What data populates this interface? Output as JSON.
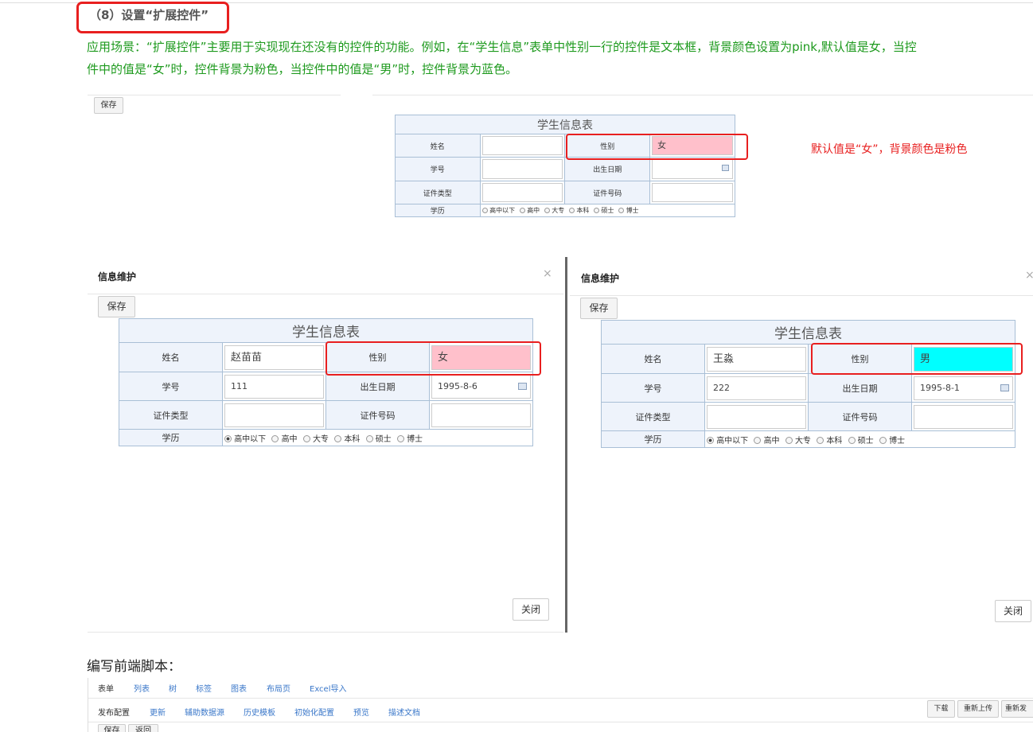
{
  "heading": "（8）设置“扩展控件”",
  "description": {
    "line1": "应用场景：“扩展控件”主要用于实现现在还没有的控件的功能。例如，在“学生信息”表单中性别一行的控件是文本框，背景颜色设置为pink,默认值是女，当控",
    "line2": "件中的值是“女”时，控件背景为粉色，当控件中的值是“男”时，控件背景为蓝色。"
  },
  "save_label": "保存",
  "close_label": "关闭",
  "dialog_title": "信息维护",
  "close_icon": "×",
  "form": {
    "caption": "学生信息表",
    "name_label": "姓名",
    "gender_label": "性别",
    "id_label": "学号",
    "birth_label": "出生日期",
    "cert_type_label": "证件类型",
    "cert_no_label": "证件号码",
    "edu_label": "学历",
    "edu_options": [
      "高中以下",
      "高中",
      "大专",
      "本科",
      "硕士",
      "博士"
    ]
  },
  "preview": {
    "gender": "女",
    "note": "默认值是“女”，背景颜色是粉色"
  },
  "dialog_left": {
    "name": "赵苗苗",
    "gender": "女",
    "id": "111",
    "birth": "1995-8-6"
  },
  "dialog_right": {
    "name": "王淼",
    "gender": "男",
    "id": "222",
    "birth": "1995-8-1"
  },
  "colors": {
    "female_bg": "#ffc0cb",
    "male_bg": "#00ffff",
    "highlight": "#e81f1f"
  },
  "script_heading": "编写前端脚本：",
  "designer": {
    "tabs": [
      "表单",
      "列表",
      "树",
      "标签",
      "图表",
      "布局页",
      "Excel导入"
    ],
    "subtabs": [
      "发布配置",
      "更新",
      "辅助数据源",
      "历史模板",
      "初始化配置",
      "预览",
      "描述文档"
    ],
    "right_buttons": [
      "下载",
      "重新上传",
      "重新发"
    ],
    "bottom_buttons": [
      "保存",
      "返回"
    ]
  }
}
